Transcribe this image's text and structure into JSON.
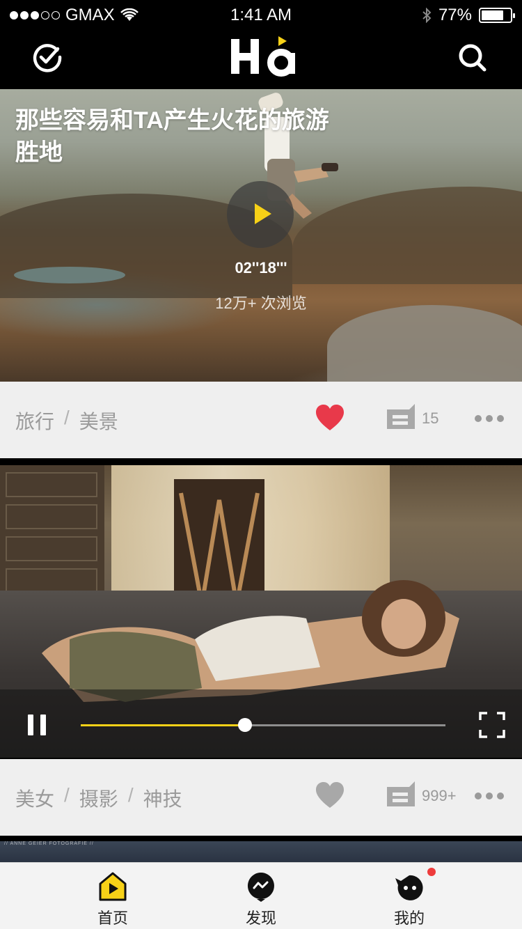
{
  "status_bar": {
    "carrier": "GMAX",
    "time": "1:41 AM",
    "battery": "77%",
    "battery_level": 0.77
  },
  "nav": {
    "logo_text": "Ha",
    "accent_color": "#f7d117"
  },
  "feed": [
    {
      "title": "那些容易和TA产生火花的旅游胜地",
      "duration": "02''18'''",
      "views": "12万+ 次浏览",
      "tags": [
        "旅行",
        "美景"
      ],
      "liked": true,
      "comment_count": "15"
    },
    {
      "tags": [
        "美女",
        "摄影",
        "神技"
      ],
      "liked": false,
      "comment_count": "999+",
      "progress": 0.45
    },
    {
      "credit": "// ANNE GEIER FOTOGRAFIE //"
    }
  ],
  "tab_bar": {
    "items": [
      {
        "label": "首页",
        "icon": "home-play-icon",
        "active": true
      },
      {
        "label": "发现",
        "icon": "discover-icon",
        "active": false
      },
      {
        "label": "我的",
        "icon": "profile-icon",
        "active": false,
        "badge": true
      }
    ]
  },
  "colors": {
    "like_active": "#e8394a",
    "like_inactive": "#a8a8a8",
    "progress": "#f7d117"
  }
}
